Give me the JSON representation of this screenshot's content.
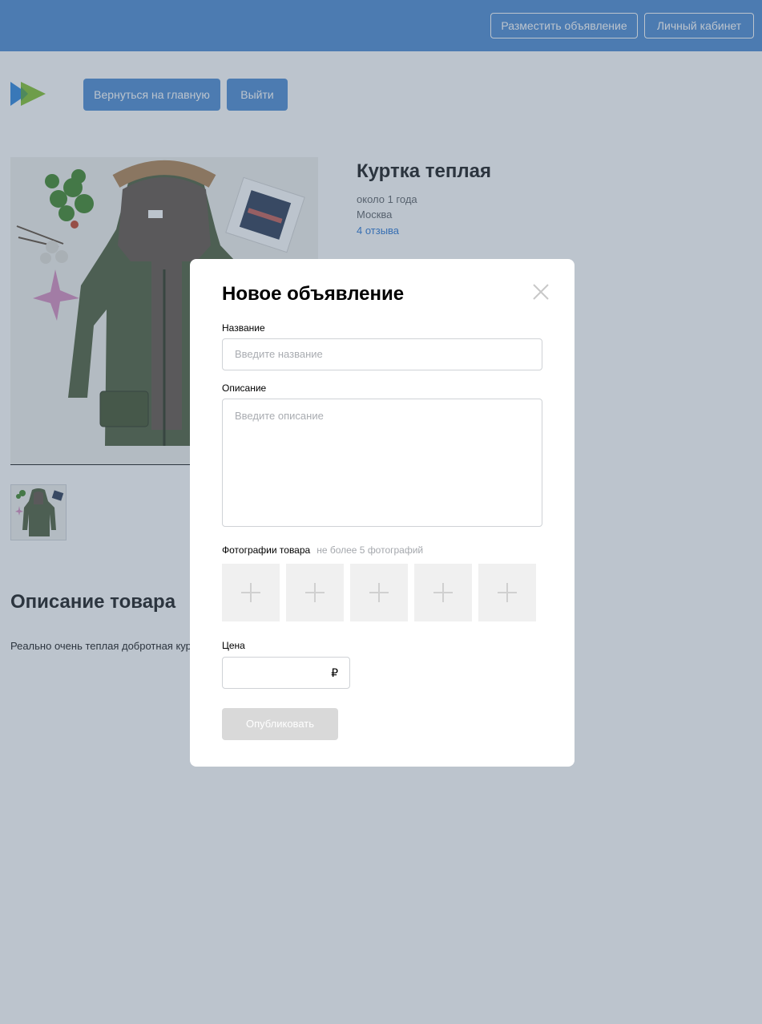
{
  "header": {
    "post_ad_label": "Разместить объявление",
    "cabinet_label": "Личный кабинет"
  },
  "nav": {
    "home_label": "Вернуться на главную",
    "logout_label": "Выйти"
  },
  "product": {
    "title": "Куртка теплая",
    "age": "около 1 года",
    "city": "Москва",
    "reviews": "4 отзыва",
    "description_heading": "Описание товара",
    "description_text": "Реально очень теплая добротная куртка"
  },
  "modal": {
    "title": "Новое объявление",
    "name_label": "Название",
    "name_placeholder": "Введите название",
    "description_label": "Описание",
    "description_placeholder": "Введите описание",
    "photos_label": "Фотографии товара",
    "photos_hint": "не более 5 фотографий",
    "price_label": "Цена",
    "currency": "₽",
    "publish_label": "Опубликовать"
  },
  "colors": {
    "accent": "#5a94d6",
    "overlay": "#304662",
    "disabled_button": "#d9d9d9"
  },
  "icons": {
    "close": "close-icon",
    "add_photo": "plus-icon"
  }
}
